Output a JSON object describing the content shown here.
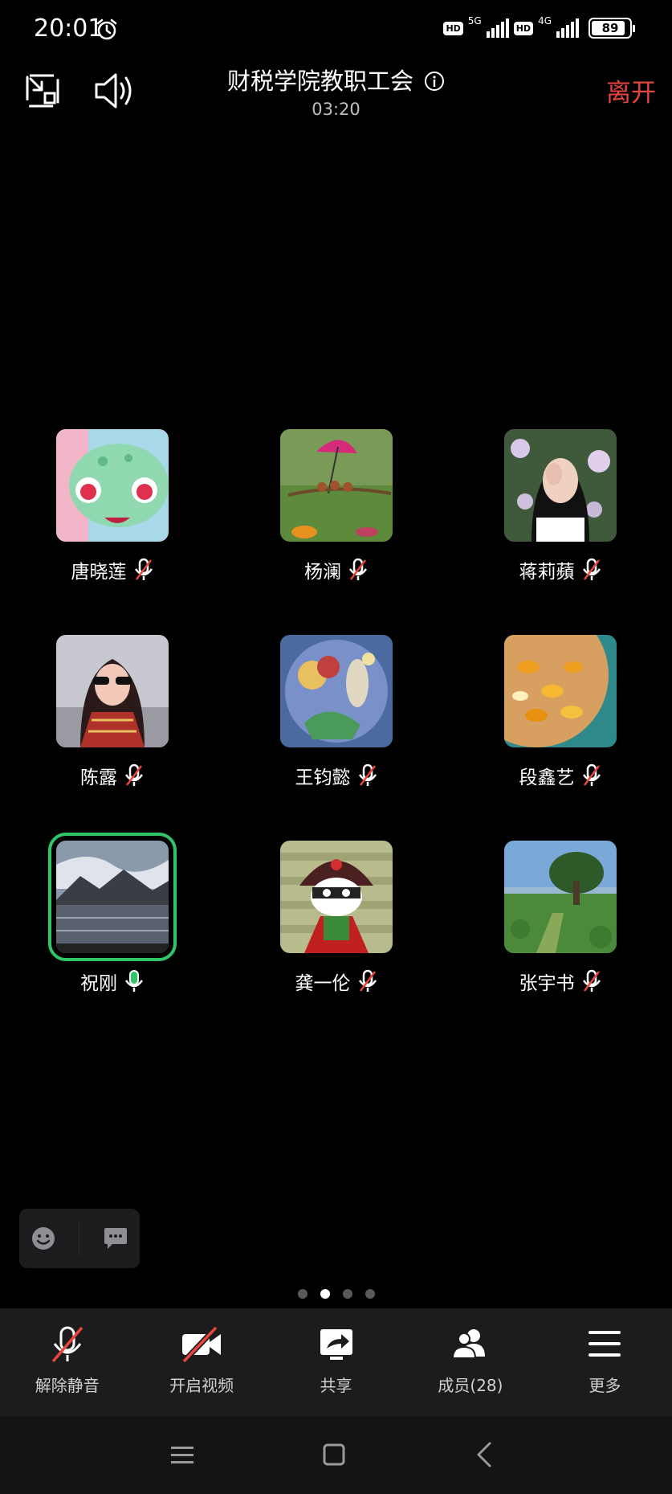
{
  "status_bar": {
    "time": "20:01",
    "network_1": "5G",
    "network_2": "4G",
    "hd_label": "HD",
    "battery_value": "89",
    "battery_level": 0.89
  },
  "header": {
    "title": "财税学院教职工会",
    "timer": "03:20",
    "leave_label": "离开"
  },
  "participants": [
    {
      "name": "唐晓莲",
      "muted": true
    },
    {
      "name": "杨澜",
      "muted": true
    },
    {
      "name": "蒋莉蘋",
      "muted": true
    },
    {
      "name": "陈露",
      "muted": true
    },
    {
      "name": "王钧懿",
      "muted": true
    },
    {
      "name": "段鑫艺",
      "muted": true
    },
    {
      "name": "祝刚",
      "muted": false,
      "speaking": true
    },
    {
      "name": "龚一伦",
      "muted": true
    },
    {
      "name": "张宇书",
      "muted": true
    }
  ],
  "pagination": {
    "pages": 4,
    "current": 2
  },
  "toolbar": {
    "unmute_label": "解除静音",
    "video_label": "开启视频",
    "share_label": "共享",
    "members_label": "成员(28)",
    "more_label": "更多"
  },
  "colors": {
    "leave": "#e8453c",
    "speaking": "#2fc667",
    "muted_slash": "#e8453c",
    "toolbar_bg": "#1c1c1e"
  }
}
